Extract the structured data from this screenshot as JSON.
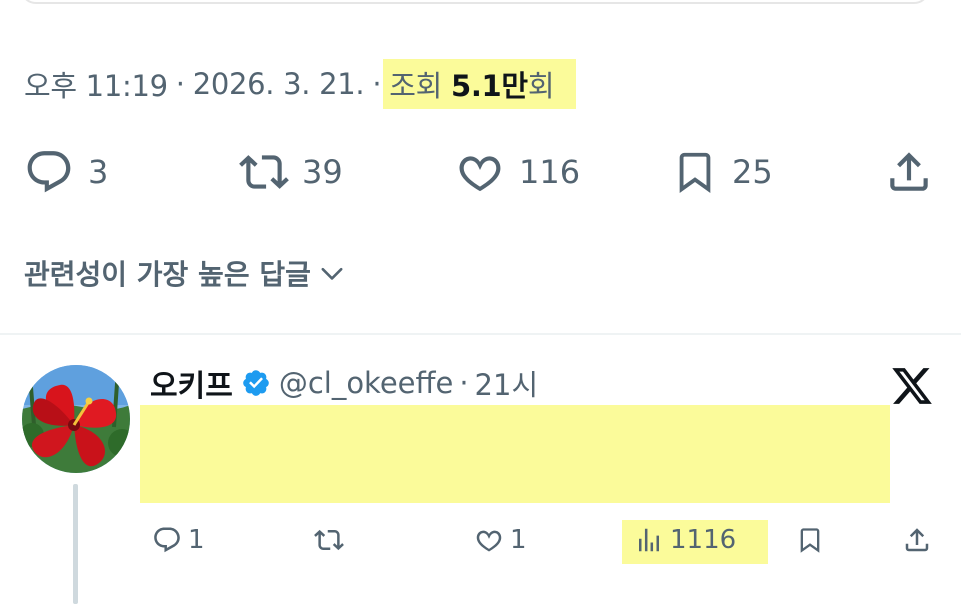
{
  "tweet_meta": {
    "time": "오후 11:19",
    "date": "2026. 3. 21.",
    "separator": "·",
    "views_prefix": "조회",
    "views_count": "5.1만",
    "views_suffix": "회"
  },
  "actions": {
    "replies": "3",
    "retweets": "39",
    "likes": "116",
    "bookmarks": "25"
  },
  "replies_sort": {
    "label": "관련성이 가장 높은 답글"
  },
  "reply": {
    "display_name": "오키프",
    "handle": "@cl_okeeffe",
    "dot": "·",
    "time_ago": "21시",
    "actions": {
      "replies": "1",
      "likes": "1",
      "views": "1116"
    }
  },
  "colors": {
    "highlight": "#fbfb9a",
    "secondary_text": "#536471",
    "verified_blue": "#1d9bf0"
  },
  "icons": {
    "reply": "reply-icon",
    "retweet": "retweet-icon",
    "like": "heart-icon",
    "bookmark": "bookmark-icon",
    "share": "share-icon",
    "views": "views-icon",
    "verified": "verified-badge-icon",
    "chevron": "chevron-down-icon",
    "x_logo": "x-logo-icon"
  }
}
